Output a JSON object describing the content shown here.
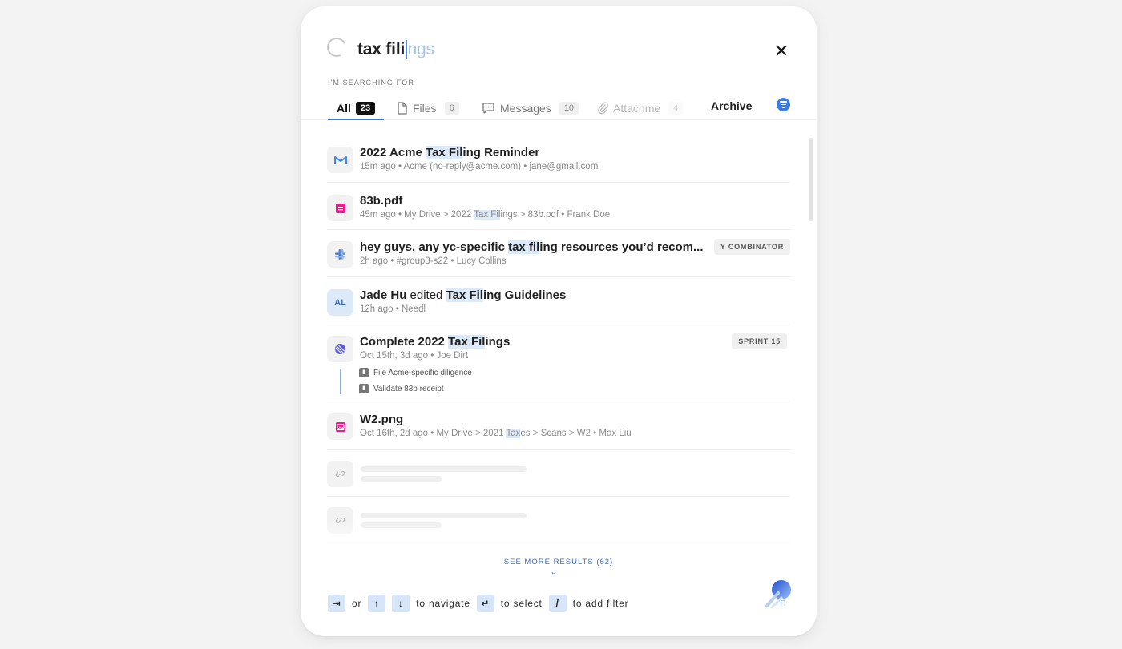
{
  "search": {
    "typed": "tax fili",
    "suggestion": "ngs",
    "label": "I'M SEARCHING FOR"
  },
  "tabs": [
    {
      "label": "All",
      "count": "23",
      "icon": "none",
      "state": "active"
    },
    {
      "label": "Files",
      "count": "6",
      "icon": "file-icon",
      "state": "normal"
    },
    {
      "label": "Messages",
      "count": "10",
      "icon": "message-icon",
      "state": "normal"
    },
    {
      "label": "Attachme",
      "count": "4",
      "icon": "paperclip-icon",
      "state": "faded"
    }
  ],
  "archive_label": "Archive",
  "results": [
    {
      "icon": "gmail-icon",
      "title_parts": [
        {
          "t": "2022 Acme "
        },
        {
          "t": "Tax Fil",
          "hl": true
        },
        {
          "t": "ing Reminder"
        }
      ],
      "sub_parts": [
        {
          "t": "15m ago • Acme (no-reply@acme.com) • jane@gmail.com"
        }
      ]
    },
    {
      "icon": "doc-icon",
      "title_parts": [
        {
          "t": "83b.pdf"
        }
      ],
      "sub_parts": [
        {
          "t": "45m ago • My Drive > 2022 "
        },
        {
          "t": "Tax Fil",
          "hl": true
        },
        {
          "t": "ings > 83b.pdf • Frank Doe"
        }
      ]
    },
    {
      "icon": "slack-icon",
      "title_parts": [
        {
          "t": "hey guys, any yc-specific "
        },
        {
          "t": "tax fil",
          "hl": true
        },
        {
          "t": "ing resources you’d recom..."
        }
      ],
      "sub_parts": [
        {
          "t": "2h ago • #group3-s22 • Lucy Collins"
        }
      ],
      "tag": "Y COMBINATOR"
    },
    {
      "icon": "avatar",
      "avatar_initials": "AL",
      "title_parts": [
        {
          "t": "Jade Hu"
        },
        {
          "t": " edited ",
          "norm": true
        },
        {
          "t": "Tax Fil",
          "hl": true
        },
        {
          "t": "ing Guidelines"
        }
      ],
      "sub_parts": [
        {
          "t": "12h ago • Needl"
        }
      ]
    },
    {
      "icon": "linear-icon",
      "title_parts": [
        {
          "t": "Complete 2022 "
        },
        {
          "t": "Tax Fil",
          "hl": true
        },
        {
          "t": "ings"
        }
      ],
      "sub_parts": [
        {
          "t": "Oct 15th, 3d ago • Joe Dirt"
        }
      ],
      "tag": "SPRINT 15",
      "subtasks": [
        "File Acme-specific diligence",
        "Validate 83b receipt"
      ]
    },
    {
      "icon": "image-icon",
      "title_parts": [
        {
          "t": "W2.png"
        }
      ],
      "sub_parts": [
        {
          "t": "Oct 16th, 2d ago • My Drive > 2021 "
        },
        {
          "t": "Tax",
          "hl": true
        },
        {
          "t": "es > Scans > W2 • Max Liu"
        }
      ]
    }
  ],
  "see_more": "SEE MORE RESULTS (62)",
  "footer": {
    "or": "or",
    "navigate": "to navigate",
    "select": "to select",
    "filter": "to add filter",
    "key_slash": "/"
  },
  "colors": {
    "accent": "#3a7bea",
    "highlight": "#dbe9f8",
    "gmail": "#4285f4",
    "doc": "#e91e8c",
    "slack": "#4a7fd8",
    "linear": "#5b5bd6"
  }
}
